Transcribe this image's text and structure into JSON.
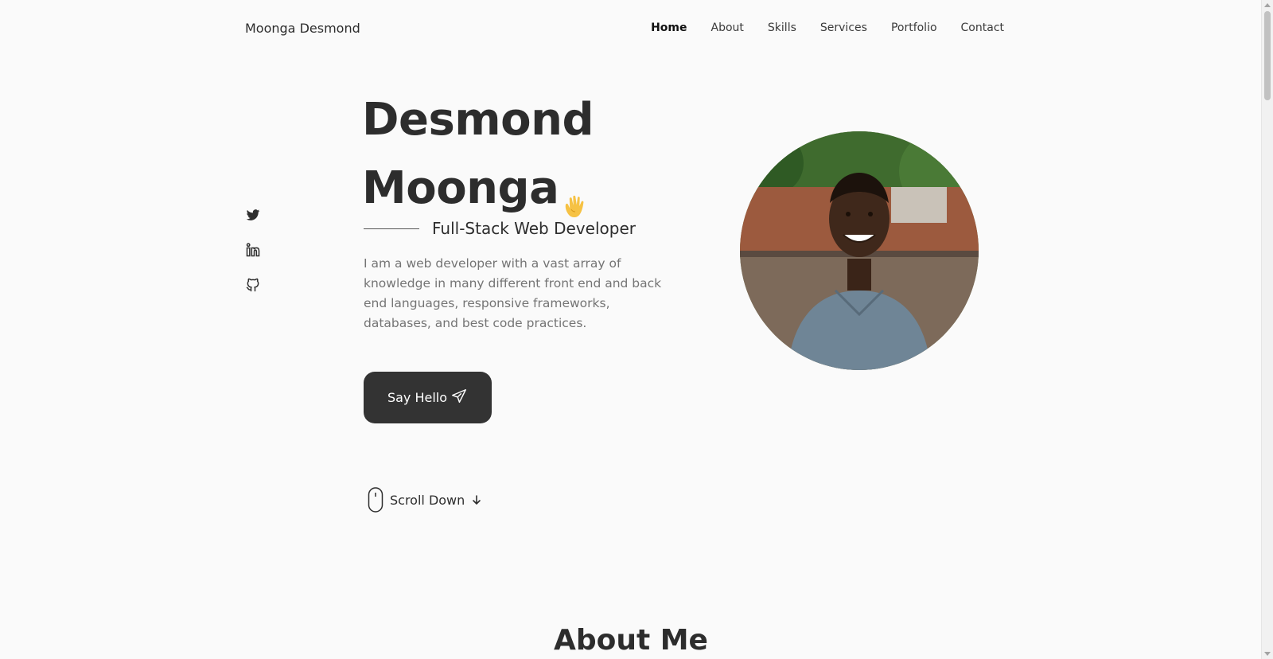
{
  "header": {
    "brand": "Moonga Desmond",
    "nav": [
      {
        "label": "Home",
        "active": true
      },
      {
        "label": "About"
      },
      {
        "label": "Skills"
      },
      {
        "label": "Services"
      },
      {
        "label": "Portfolio"
      },
      {
        "label": "Contact"
      }
    ]
  },
  "social": [
    {
      "icon": "twitter-icon"
    },
    {
      "icon": "linkedin-icon"
    },
    {
      "icon": "github-icon"
    }
  ],
  "hero": {
    "first_name": "Desmond",
    "last_name": "Moonga",
    "wave_icon": "waving-hand-icon",
    "subtitle": "Full-Stack Web Developer",
    "description": "I am a web developer with a vast array of knowledge in many different front end and back end languages, responsive frameworks, databases, and best code practices.",
    "cta_label": "Say Hello",
    "cta_icon": "paper-plane-icon",
    "scroll_label": "Scroll Down"
  },
  "about": {
    "heading": "About Me"
  },
  "colors": {
    "background": "#fafafa",
    "text": "#2d2d2d",
    "muted": "#747474",
    "button": "#333333"
  }
}
